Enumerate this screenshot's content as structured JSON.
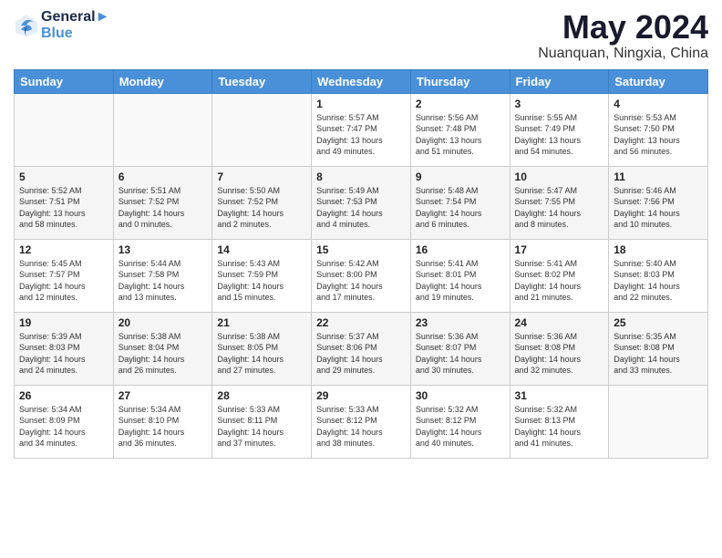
{
  "header": {
    "logo_line1": "General",
    "logo_line2": "Blue",
    "month_title": "May 2024",
    "location": "Nuanquan, Ningxia, China"
  },
  "days_of_week": [
    "Sunday",
    "Monday",
    "Tuesday",
    "Wednesday",
    "Thursday",
    "Friday",
    "Saturday"
  ],
  "weeks": [
    {
      "alt": false,
      "days": [
        {
          "num": "",
          "lines": []
        },
        {
          "num": "",
          "lines": []
        },
        {
          "num": "",
          "lines": []
        },
        {
          "num": "1",
          "lines": [
            "Sunrise: 5:57 AM",
            "Sunset: 7:47 PM",
            "Daylight: 13 hours",
            "and 49 minutes."
          ]
        },
        {
          "num": "2",
          "lines": [
            "Sunrise: 5:56 AM",
            "Sunset: 7:48 PM",
            "Daylight: 13 hours",
            "and 51 minutes."
          ]
        },
        {
          "num": "3",
          "lines": [
            "Sunrise: 5:55 AM",
            "Sunset: 7:49 PM",
            "Daylight: 13 hours",
            "and 54 minutes."
          ]
        },
        {
          "num": "4",
          "lines": [
            "Sunrise: 5:53 AM",
            "Sunset: 7:50 PM",
            "Daylight: 13 hours",
            "and 56 minutes."
          ]
        }
      ]
    },
    {
      "alt": true,
      "days": [
        {
          "num": "5",
          "lines": [
            "Sunrise: 5:52 AM",
            "Sunset: 7:51 PM",
            "Daylight: 13 hours",
            "and 58 minutes."
          ]
        },
        {
          "num": "6",
          "lines": [
            "Sunrise: 5:51 AM",
            "Sunset: 7:52 PM",
            "Daylight: 14 hours",
            "and 0 minutes."
          ]
        },
        {
          "num": "7",
          "lines": [
            "Sunrise: 5:50 AM",
            "Sunset: 7:52 PM",
            "Daylight: 14 hours",
            "and 2 minutes."
          ]
        },
        {
          "num": "8",
          "lines": [
            "Sunrise: 5:49 AM",
            "Sunset: 7:53 PM",
            "Daylight: 14 hours",
            "and 4 minutes."
          ]
        },
        {
          "num": "9",
          "lines": [
            "Sunrise: 5:48 AM",
            "Sunset: 7:54 PM",
            "Daylight: 14 hours",
            "and 6 minutes."
          ]
        },
        {
          "num": "10",
          "lines": [
            "Sunrise: 5:47 AM",
            "Sunset: 7:55 PM",
            "Daylight: 14 hours",
            "and 8 minutes."
          ]
        },
        {
          "num": "11",
          "lines": [
            "Sunrise: 5:46 AM",
            "Sunset: 7:56 PM",
            "Daylight: 14 hours",
            "and 10 minutes."
          ]
        }
      ]
    },
    {
      "alt": false,
      "days": [
        {
          "num": "12",
          "lines": [
            "Sunrise: 5:45 AM",
            "Sunset: 7:57 PM",
            "Daylight: 14 hours",
            "and 12 minutes."
          ]
        },
        {
          "num": "13",
          "lines": [
            "Sunrise: 5:44 AM",
            "Sunset: 7:58 PM",
            "Daylight: 14 hours",
            "and 13 minutes."
          ]
        },
        {
          "num": "14",
          "lines": [
            "Sunrise: 5:43 AM",
            "Sunset: 7:59 PM",
            "Daylight: 14 hours",
            "and 15 minutes."
          ]
        },
        {
          "num": "15",
          "lines": [
            "Sunrise: 5:42 AM",
            "Sunset: 8:00 PM",
            "Daylight: 14 hours",
            "and 17 minutes."
          ]
        },
        {
          "num": "16",
          "lines": [
            "Sunrise: 5:41 AM",
            "Sunset: 8:01 PM",
            "Daylight: 14 hours",
            "and 19 minutes."
          ]
        },
        {
          "num": "17",
          "lines": [
            "Sunrise: 5:41 AM",
            "Sunset: 8:02 PM",
            "Daylight: 14 hours",
            "and 21 minutes."
          ]
        },
        {
          "num": "18",
          "lines": [
            "Sunrise: 5:40 AM",
            "Sunset: 8:03 PM",
            "Daylight: 14 hours",
            "and 22 minutes."
          ]
        }
      ]
    },
    {
      "alt": true,
      "days": [
        {
          "num": "19",
          "lines": [
            "Sunrise: 5:39 AM",
            "Sunset: 8:03 PM",
            "Daylight: 14 hours",
            "and 24 minutes."
          ]
        },
        {
          "num": "20",
          "lines": [
            "Sunrise: 5:38 AM",
            "Sunset: 8:04 PM",
            "Daylight: 14 hours",
            "and 26 minutes."
          ]
        },
        {
          "num": "21",
          "lines": [
            "Sunrise: 5:38 AM",
            "Sunset: 8:05 PM",
            "Daylight: 14 hours",
            "and 27 minutes."
          ]
        },
        {
          "num": "22",
          "lines": [
            "Sunrise: 5:37 AM",
            "Sunset: 8:06 PM",
            "Daylight: 14 hours",
            "and 29 minutes."
          ]
        },
        {
          "num": "23",
          "lines": [
            "Sunrise: 5:36 AM",
            "Sunset: 8:07 PM",
            "Daylight: 14 hours",
            "and 30 minutes."
          ]
        },
        {
          "num": "24",
          "lines": [
            "Sunrise: 5:36 AM",
            "Sunset: 8:08 PM",
            "Daylight: 14 hours",
            "and 32 minutes."
          ]
        },
        {
          "num": "25",
          "lines": [
            "Sunrise: 5:35 AM",
            "Sunset: 8:08 PM",
            "Daylight: 14 hours",
            "and 33 minutes."
          ]
        }
      ]
    },
    {
      "alt": false,
      "days": [
        {
          "num": "26",
          "lines": [
            "Sunrise: 5:34 AM",
            "Sunset: 8:09 PM",
            "Daylight: 14 hours",
            "and 34 minutes."
          ]
        },
        {
          "num": "27",
          "lines": [
            "Sunrise: 5:34 AM",
            "Sunset: 8:10 PM",
            "Daylight: 14 hours",
            "and 36 minutes."
          ]
        },
        {
          "num": "28",
          "lines": [
            "Sunrise: 5:33 AM",
            "Sunset: 8:11 PM",
            "Daylight: 14 hours",
            "and 37 minutes."
          ]
        },
        {
          "num": "29",
          "lines": [
            "Sunrise: 5:33 AM",
            "Sunset: 8:12 PM",
            "Daylight: 14 hours",
            "and 38 minutes."
          ]
        },
        {
          "num": "30",
          "lines": [
            "Sunrise: 5:32 AM",
            "Sunset: 8:12 PM",
            "Daylight: 14 hours",
            "and 40 minutes."
          ]
        },
        {
          "num": "31",
          "lines": [
            "Sunrise: 5:32 AM",
            "Sunset: 8:13 PM",
            "Daylight: 14 hours",
            "and 41 minutes."
          ]
        },
        {
          "num": "",
          "lines": []
        }
      ]
    }
  ]
}
